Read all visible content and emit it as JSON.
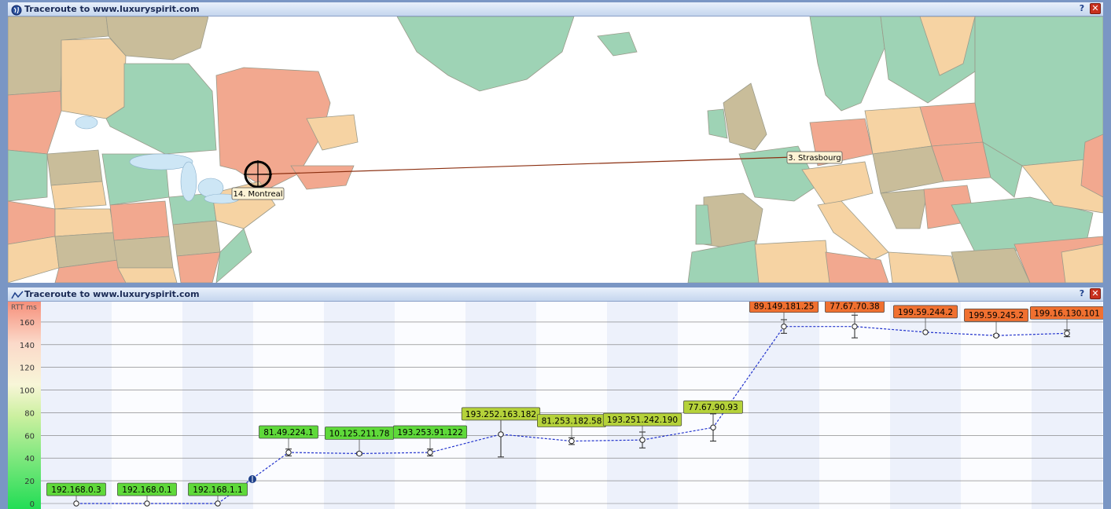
{
  "map_window": {
    "title": "Traceroute to www.luxuryspirit.com",
    "help_label": "?",
    "close_label": "✕",
    "title_icon": "globe-icon",
    "markers": [
      {
        "label": "14. Montreal",
        "type": "current-hop"
      },
      {
        "label": "3. Strasbourg",
        "type": "hop"
      }
    ],
    "route_color": "#8b2f10"
  },
  "chart_window": {
    "title": "Traceroute to www.luxuryspirit.com",
    "help_label": "?",
    "close_label": "✕",
    "title_icon": "chart-line-icon"
  },
  "chart_data": {
    "type": "line",
    "ylabel": "RTT ms",
    "ylim": [
      0,
      180
    ],
    "yticks": [
      0,
      20,
      40,
      60,
      80,
      100,
      120,
      140,
      160
    ],
    "grid": true,
    "hops": [
      {
        "ip": "192.168.0.3",
        "rtt": 0,
        "err": 0
      },
      {
        "ip": "192.168.0.1",
        "rtt": 0,
        "err": 0
      },
      {
        "ip": "192.168.1.1",
        "rtt": 0,
        "err": 0
      },
      {
        "ip": "81.49.224.1",
        "rtt": 45,
        "err": 3
      },
      {
        "ip": "10.125.211.78",
        "rtt": 44,
        "err": 1
      },
      {
        "ip": "193.253.91.122",
        "rtt": 45,
        "err": 3
      },
      {
        "ip": "193.252.163.182",
        "rtt": 61,
        "err": 20
      },
      {
        "ip": "81.253.182.58",
        "rtt": 55,
        "err": 3
      },
      {
        "ip": "193.251.242.190",
        "rtt": 56,
        "err": 7
      },
      {
        "ip": "77.67.90.93",
        "rtt": 67,
        "err": 12
      },
      {
        "ip": "89.149.181.25",
        "rtt": 156,
        "err": 6
      },
      {
        "ip": "77.67.70.38",
        "rtt": 156,
        "err": 10
      },
      {
        "ip": "199.59.244.2",
        "rtt": 151,
        "err": 0
      },
      {
        "ip": "199.59.245.2",
        "rtt": 148,
        "err": 1
      },
      {
        "ip": "199.16.130.101",
        "rtt": 150,
        "err": 3
      }
    ],
    "colors": {
      "low": "#5fd93a",
      "mid": "#b5d23a",
      "high": "#f07030",
      "line": "#2233cc"
    }
  }
}
